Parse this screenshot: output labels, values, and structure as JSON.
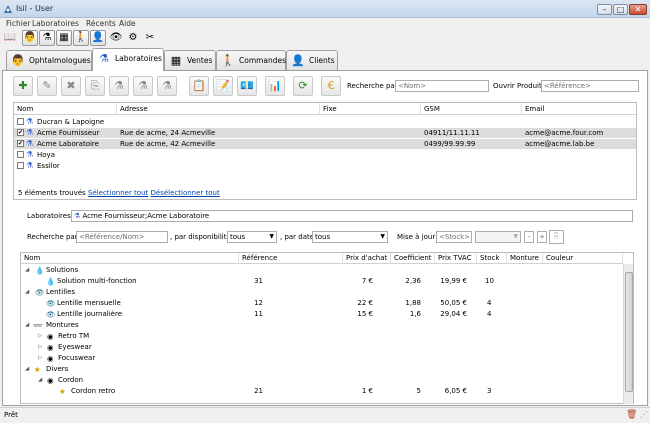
{
  "window": {
    "title": "Isil - User"
  },
  "menu": [
    "Fichier",
    "Laboratoires",
    "Récents",
    "Aide"
  ],
  "tabs": [
    {
      "label": "Ophtalmologues",
      "icon": "doctor-icon"
    },
    {
      "label": "Laboratoires",
      "icon": "flask-icon"
    },
    {
      "label": "Ventes",
      "icon": "cash-register-icon"
    },
    {
      "label": "Commandes",
      "icon": "delivery-person-icon"
    },
    {
      "label": "Clients",
      "icon": "client-icon"
    }
  ],
  "search": {
    "label": "Recherche par",
    "placeholder": "<Nom>",
    "open_product_label": "Ouvrir Produit",
    "open_product_placeholder": "<Référence>"
  },
  "labs_table": {
    "columns": [
      "Nom",
      "Adresse",
      "Fixe",
      "GSM",
      "Email"
    ],
    "rows": [
      {
        "checked": false,
        "name": "Ducran & Lapoigne",
        "address": "",
        "fixe": "",
        "gsm": "",
        "email": ""
      },
      {
        "checked": true,
        "name": "Acme Fournisseur",
        "address": "Rue de acme, 24 Acmeville",
        "fixe": "",
        "gsm": "04911/11.11.11",
        "email": "acme@acme.four.com"
      },
      {
        "checked": true,
        "name": "Acme Laboratoire",
        "address": "Rue de acme, 42 Acmeville",
        "fixe": "",
        "gsm": "0499/99.99.99",
        "email": "acme@acme.lab.be"
      },
      {
        "checked": false,
        "name": "Hoya",
        "address": "",
        "fixe": "",
        "gsm": "",
        "email": ""
      },
      {
        "checked": false,
        "name": "Essilor",
        "address": "",
        "fixe": "",
        "gsm": "",
        "email": ""
      }
    ],
    "count_text": "5 éléments trouvés",
    "select_all": "Sélectionner tout",
    "deselect_all": "Désélectionner tout"
  },
  "filter": {
    "labs_label": "Laboratoires",
    "labs_value": "Acme Fournisseur;Acme Laboratoire",
    "search_label": "Recherche par",
    "search_placeholder": "<Référence/Nom>",
    "dispo_label": ", par disponibilité",
    "dispo_value": "tous",
    "date_label": ", par date",
    "date_value": "tous",
    "update_label": "Mise à jour",
    "stock_placeholder": "<Stock>"
  },
  "product_table": {
    "columns": [
      "Nom",
      "Référence",
      "Prix d'achat",
      "Coefficient",
      "Prix TVAC",
      "Stock",
      "Monture",
      "Couleur"
    ],
    "rows": [
      {
        "level": 0,
        "expanded": true,
        "icon": "drop-icon",
        "name": "Solutions",
        "ref": "",
        "prix": "",
        "coef": "",
        "tvac": "",
        "stock": ""
      },
      {
        "level": 1,
        "leaf": true,
        "icon": "drop-icon",
        "name": "Solution multi-fonction",
        "ref": "31",
        "prix": "7 €",
        "coef": "2,36",
        "tvac": "19,99 €",
        "stock": "10"
      },
      {
        "level": 0,
        "expanded": true,
        "icon": "eye-icon",
        "name": "Lentilles",
        "ref": "",
        "prix": "",
        "coef": "",
        "tvac": "",
        "stock": ""
      },
      {
        "level": 1,
        "leaf": true,
        "icon": "eye-icon",
        "name": "Lentille mensuelle",
        "ref": "12",
        "prix": "22 €",
        "coef": "1,88",
        "tvac": "50,05 €",
        "stock": "4"
      },
      {
        "level": 1,
        "leaf": true,
        "icon": "eye-icon",
        "name": "Lentille journalière",
        "ref": "11",
        "prix": "15 €",
        "coef": "1,6",
        "tvac": "29,04 €",
        "stock": "4"
      },
      {
        "level": 0,
        "expanded": true,
        "icon": "glasses-icon",
        "name": "Montures",
        "ref": "",
        "prix": "",
        "coef": "",
        "tvac": "",
        "stock": ""
      },
      {
        "level": 1,
        "expanded": false,
        "icon": "spiral-icon",
        "name": "Retro TM",
        "ref": "",
        "prix": "",
        "coef": "",
        "tvac": "",
        "stock": ""
      },
      {
        "level": 1,
        "expanded": false,
        "icon": "spiral-icon",
        "name": "Eyeswear",
        "ref": "",
        "prix": "",
        "coef": "",
        "tvac": "",
        "stock": ""
      },
      {
        "level": 1,
        "expanded": false,
        "icon": "spiral-icon",
        "name": "Focuswear",
        "ref": "",
        "prix": "",
        "coef": "",
        "tvac": "",
        "stock": ""
      },
      {
        "level": 0,
        "expanded": true,
        "icon": "star-icon",
        "name": "Divers",
        "ref": "",
        "prix": "",
        "coef": "",
        "tvac": "",
        "stock": ""
      },
      {
        "level": 1,
        "expanded": true,
        "icon": "spiral-icon",
        "name": "Cordon",
        "ref": "",
        "prix": "",
        "coef": "",
        "tvac": "",
        "stock": ""
      },
      {
        "level": 2,
        "leaf": true,
        "icon": "star-icon",
        "name": "Cordon retro",
        "ref": "21",
        "prix": "1 €",
        "coef": "5",
        "tvac": "6,05 €",
        "stock": "3"
      }
    ]
  },
  "status": {
    "text": "Prêt"
  },
  "colors": {
    "accent": "#2a5ad0",
    "selection": "#dcdcdc",
    "link": "#0645ad"
  }
}
